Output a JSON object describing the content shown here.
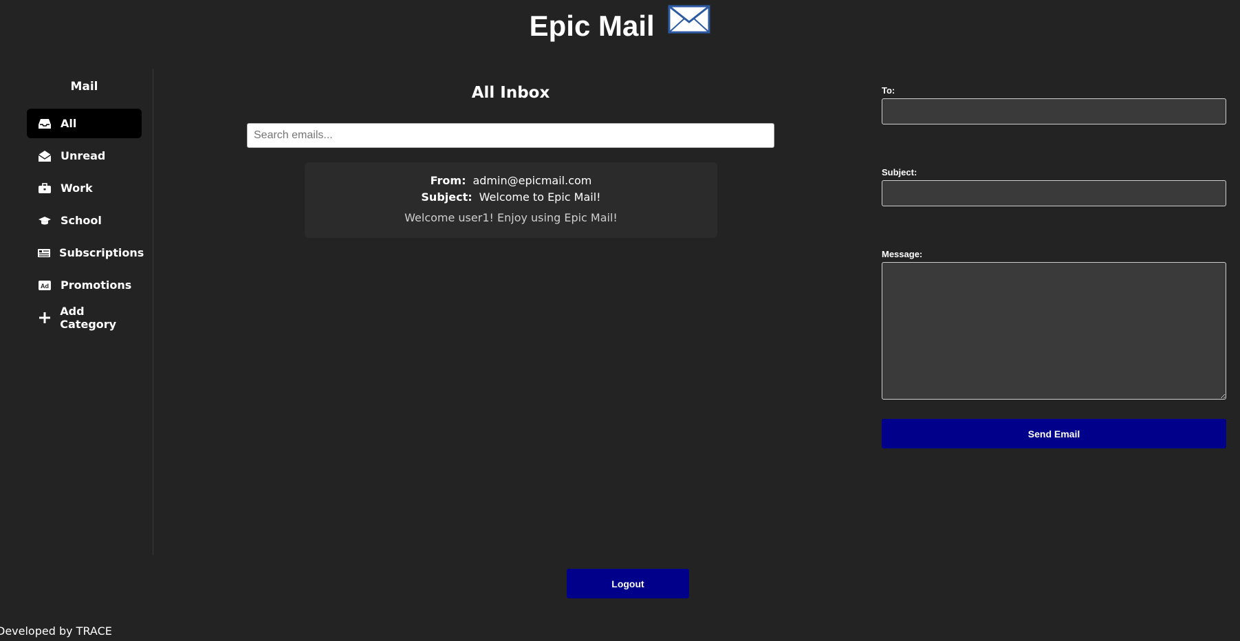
{
  "header": {
    "title": "Epic Mail",
    "icon": "envelope-icon"
  },
  "sidebar": {
    "title": "Mail",
    "items": [
      {
        "label": "All",
        "icon": "inbox-icon",
        "active": true
      },
      {
        "label": "Unread",
        "icon": "envelope-open-icon",
        "active": false
      },
      {
        "label": "Work",
        "icon": "briefcase-icon",
        "active": false
      },
      {
        "label": "School",
        "icon": "graduation-cap-icon",
        "active": false
      },
      {
        "label": "Subscriptions",
        "icon": "newspaper-icon",
        "active": false
      },
      {
        "label": "Promotions",
        "icon": "ad-icon",
        "active": false
      },
      {
        "label": "Add Category",
        "icon": "plus-icon",
        "active": false
      }
    ]
  },
  "inbox": {
    "title": "All Inbox",
    "search_placeholder": "Search emails...",
    "emails": [
      {
        "from_label": "From:",
        "from": "admin@epicmail.com",
        "subject_label": "Subject:",
        "subject": "Welcome to Epic Mail!",
        "preview": "Welcome user1! Enjoy using Epic Mail!"
      }
    ]
  },
  "compose": {
    "to_label": "To:",
    "to_value": "",
    "subject_label": "Subject:",
    "subject_value": "",
    "message_label": "Message:",
    "message_value": "",
    "send_label": "Send Email"
  },
  "logout_label": "Logout",
  "footer": {
    "text": "Developed by TRACE"
  },
  "colors": {
    "background": "#232323",
    "card": "#2b2b2b",
    "button": "#00008b",
    "active_nav": "#000000",
    "input_bg": "#3a3a3a"
  }
}
